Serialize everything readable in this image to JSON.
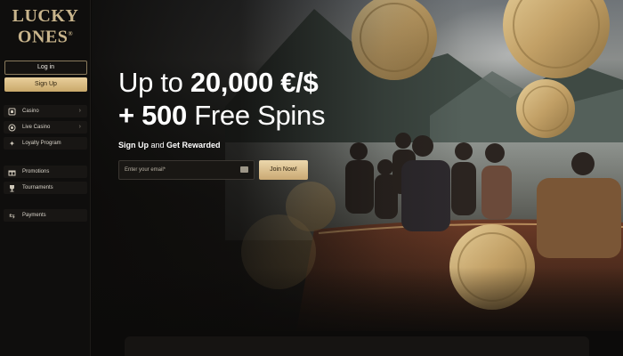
{
  "brand": {
    "line1": "LUCKY",
    "line2": "ONES",
    "mark": "®"
  },
  "auth": {
    "login_label": "Log in",
    "signup_label": "Sign Up"
  },
  "sidebar": {
    "items": [
      {
        "label": "Casino",
        "icon": "slot-icon",
        "has_chevron": true
      },
      {
        "label": "Live Casino",
        "icon": "live-icon",
        "has_chevron": true
      },
      {
        "label": "Loyalty Program",
        "icon": "star-icon",
        "has_chevron": false
      },
      {
        "label": "Promotions",
        "icon": "gift-icon",
        "has_chevron": false
      },
      {
        "label": "Tournaments",
        "icon": "trophy-icon",
        "has_chevron": false
      },
      {
        "label": "Payments",
        "icon": "transfer-icon",
        "has_chevron": false
      }
    ]
  },
  "hero": {
    "headline_pre": "Up to ",
    "headline_amount": "20,000 €/$",
    "headline_line2_bold": "+ 500",
    "headline_line2_rest": " Free Spins",
    "subhead_bold1": "Sign Up",
    "subhead_mid": " and ",
    "subhead_bold2": "Get Rewarded",
    "email_placeholder": "Enter your email*",
    "join_label": "Join Now!"
  },
  "colors": {
    "accent_gold": "#c9a86a",
    "sidebar_bg": "#0f0e0d",
    "page_bg": "#0c0b0a"
  }
}
